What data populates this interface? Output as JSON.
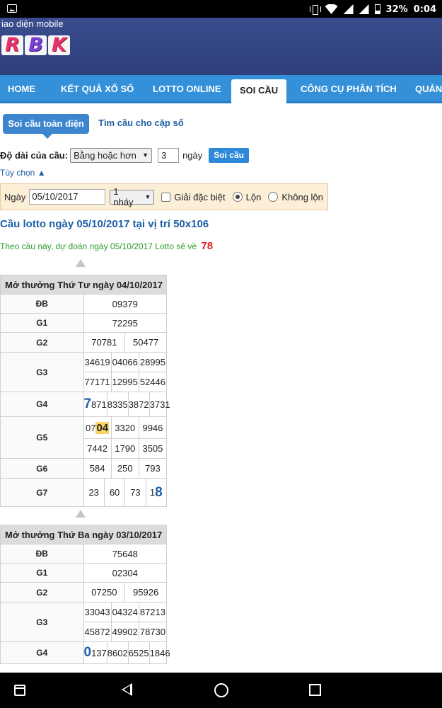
{
  "status_bar": {
    "battery": "32%",
    "time": "0:04"
  },
  "header": {
    "site_label": "iao diện mobile",
    "logo_letters": [
      "R",
      "B",
      "K"
    ]
  },
  "nav": {
    "items": [
      {
        "label": "HOME"
      },
      {
        "label": "KẾT QUẢ XỔ SỐ"
      },
      {
        "label": "LOTTO ONLINE"
      },
      {
        "label": "SOI CẦU",
        "active": true
      },
      {
        "label": "CÔNG CỤ PHÂN TÍCH"
      },
      {
        "label": "QUẢNG"
      }
    ]
  },
  "tabs": {
    "active": "Soi cầu toàn diện",
    "other": "Tìm cầu cho cặp số"
  },
  "form": {
    "length_label": "Độ dài của cầu:",
    "length_mode": "Bằng hoặc hơn",
    "days_value": "3",
    "days_unit": "ngày",
    "submit": "Soi cầu",
    "options_toggle": "Tùy chọn ▲",
    "date_label": "Ngày",
    "date_value": "05/10/2017",
    "jump_select": "1 nháy",
    "special_label": "Giải đặc biệt",
    "radio_lon": "Lộn",
    "radio_khong_lon": "Không lộn"
  },
  "result": {
    "title": "Cầu lotto ngày 05/10/2017 tại vị trí 50x106",
    "prediction_text": "Theo cầu này, dự đoán ngày 05/10/2017 Lotto sẽ về",
    "prediction_number": "78"
  },
  "draws": [
    {
      "title": "Mở thưởng Thứ Tư ngày 04/10/2017",
      "db": "09379",
      "g1": "72295",
      "g2": [
        "70781",
        "50477"
      ],
      "g3a": [
        "34619",
        "04066",
        "28995"
      ],
      "g3b": [
        "77171",
        "12995",
        "52446"
      ],
      "g4": [
        {
          "hi": "7",
          "rest": "871"
        },
        "8335",
        "3872",
        "3731"
      ],
      "g5a": [
        {
          "pre": "07",
          "hl": "04"
        },
        "3320",
        "9946"
      ],
      "g5b": [
        "7442",
        "1790",
        "3505"
      ],
      "g6": [
        "584",
        "250",
        "793"
      ],
      "g7": [
        "23",
        "60",
        "73",
        {
          "pre": "1",
          "hi": "8"
        }
      ]
    },
    {
      "title": "Mở thưởng Thứ Ba ngày 03/10/2017",
      "db": "75648",
      "g1": "02304",
      "g2": [
        "07250",
        "95926"
      ],
      "g3a": [
        "33043",
        "04324",
        "87213"
      ],
      "g3b": [
        "45872",
        "49902",
        "78730"
      ],
      "g4": [
        {
          "hi": "0",
          "rest": "137"
        },
        "8602",
        "6525",
        "1846"
      ]
    }
  ],
  "labels": {
    "db": "ĐB",
    "g1": "G1",
    "g2": "G2",
    "g3": "G3",
    "g4": "G4",
    "g5": "G5",
    "g6": "G6",
    "g7": "G7"
  }
}
